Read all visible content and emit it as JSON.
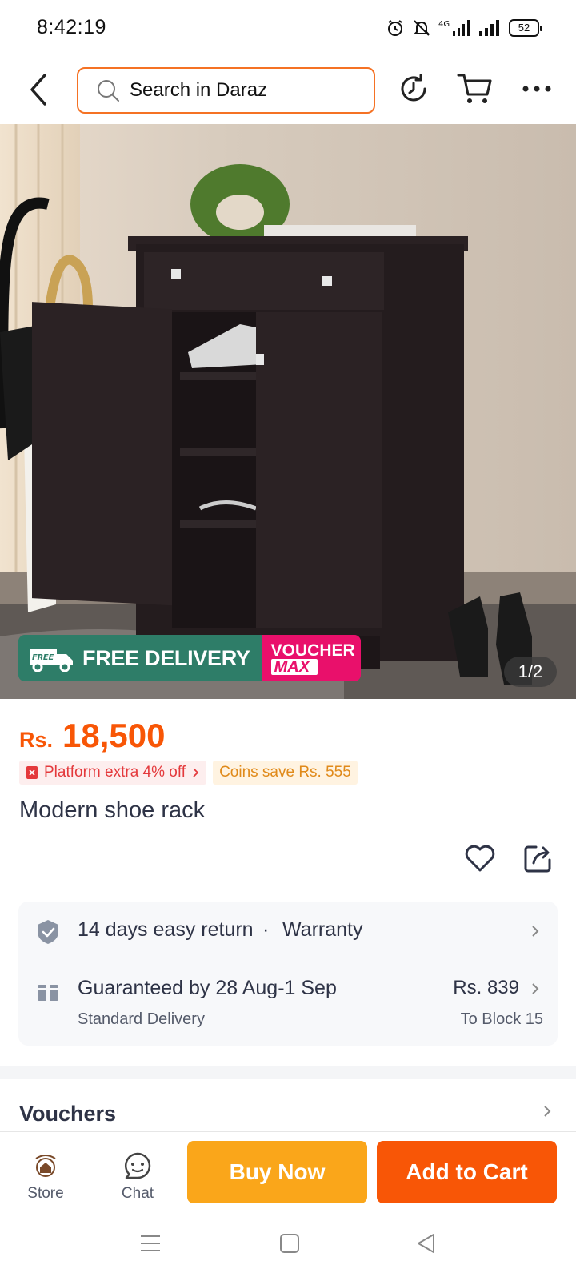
{
  "status_bar": {
    "time": "8:42:19",
    "network": "4G",
    "battery": "52"
  },
  "top_nav": {
    "search_placeholder": "Search in Daraz",
    "icons": [
      "back-icon",
      "search-icon",
      "history-icon",
      "cart-icon",
      "more-icon"
    ]
  },
  "gallery": {
    "banner_free_delivery": "FREE DELIVERY",
    "banner_free_small": "FREE",
    "banner_voucher_line1": "VOUCHER",
    "banner_voucher_line2": "MAX",
    "counter": "1/2",
    "colors": {
      "free_delivery": "#2e7d68",
      "voucher_max": "#e9106b"
    }
  },
  "product": {
    "currency": "Rs.",
    "price": "18,500",
    "promo_platform": "Platform extra 4% off",
    "promo_coins": "Coins save Rs. 555",
    "title": "Modern shoe rack",
    "accent_color": "#f85606"
  },
  "delivery": {
    "return_text": "14 days easy return",
    "dot": "·",
    "warranty": "Warranty",
    "guarantee_text": "Guaranteed by 28 Aug-1 Sep",
    "delivery_type": "Standard Delivery",
    "delivery_price": "Rs. 839",
    "delivery_to": "To Block 15"
  },
  "vouchers": {
    "title": "Vouchers"
  },
  "action_bar": {
    "store_label": "Store",
    "chat_label": "Chat",
    "buy_now_label": "Buy Now",
    "add_to_cart_label": "Add to Cart",
    "colors": {
      "buy_now": "#faa61a",
      "add_to_cart": "#f85606"
    }
  },
  "system_nav": {
    "icons": [
      "menu-icon",
      "home-square-icon",
      "back-triangle-icon"
    ]
  }
}
